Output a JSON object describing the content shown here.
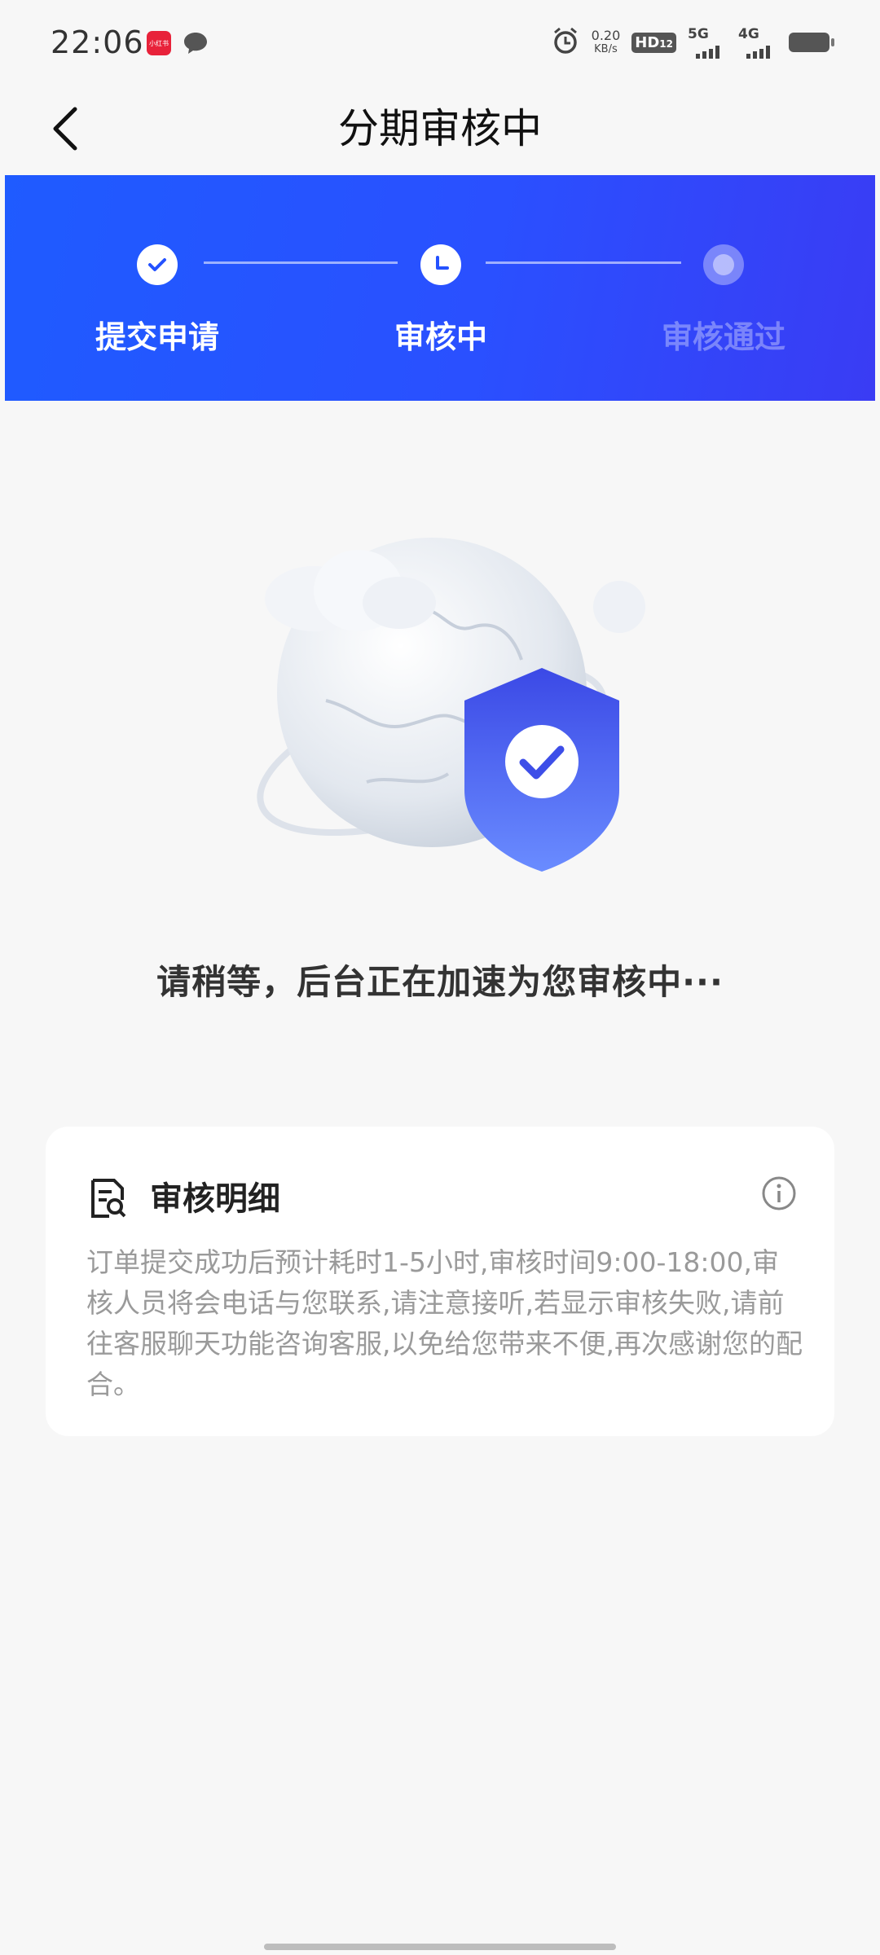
{
  "status_bar": {
    "time": "22:06",
    "app_badge": "小红书",
    "speed_value": "0.20",
    "speed_unit": "KB/s",
    "hd": "HD",
    "hd_sub": "12",
    "net1": "5G",
    "net2": "4G",
    "icons": [
      "message-icon",
      "alarm-icon",
      "signal-icon",
      "battery-icon"
    ]
  },
  "nav": {
    "title": "分期审核中",
    "back_icon": "chevron-left-icon"
  },
  "stepper": {
    "steps": [
      {
        "label": "提交申请",
        "state": "done",
        "icon": "check-icon"
      },
      {
        "label": "审核中",
        "state": "current",
        "icon": "clock-icon"
      },
      {
        "label": "审核通过",
        "state": "pending",
        "icon": "dot-icon"
      }
    ],
    "gradient": [
      "#1f5bff",
      "#3a3cf4"
    ]
  },
  "illustration": {
    "icon": "globe-shield-check-icon"
  },
  "status_message": "请稍等，后台正在加速为您审核中···",
  "detail_card": {
    "title": "审核明细",
    "title_icon": "document-search-icon",
    "info_icon": "info-icon",
    "body": " 订单提交成功后预计耗时1-5小时,审核时间9:00-18:00,审核人员将会电话与您联系,请注意接听,若显示审核失败,请前往客服聊天功能咨询客服,以免给您带来不便,再次感谢您的配合。"
  },
  "colors": {
    "accent": "#2452ff",
    "background": "#f7f7f7",
    "body_text": "#9a9a9a"
  }
}
